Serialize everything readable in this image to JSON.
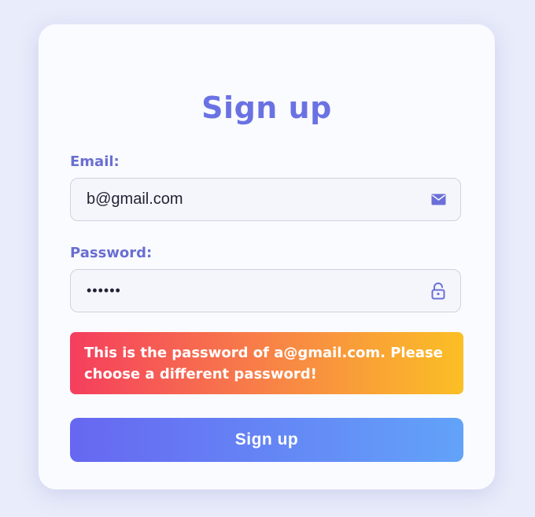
{
  "form": {
    "title": "Sign up",
    "email_label": "Email:",
    "email_value": "b@gmail.com",
    "email_icon": "mail-icon",
    "password_label": "Password:",
    "password_value": "••••••",
    "password_icon": "unlock-icon",
    "error_message": "This is the password of a@gmail.com. Please choose a different password!",
    "submit_label": "Sign up"
  },
  "colors": {
    "page_background": "#e9ecfa",
    "card_background": "#fafbff",
    "title": "#6a72e3",
    "label": "#6a6fd0",
    "icon": "#6b6fd8",
    "alert_gradient_start": "#f53e5e",
    "alert_gradient_end": "#fbbf25",
    "button_gradient_start": "#6767f1",
    "button_gradient_end": "#62a3f9"
  }
}
